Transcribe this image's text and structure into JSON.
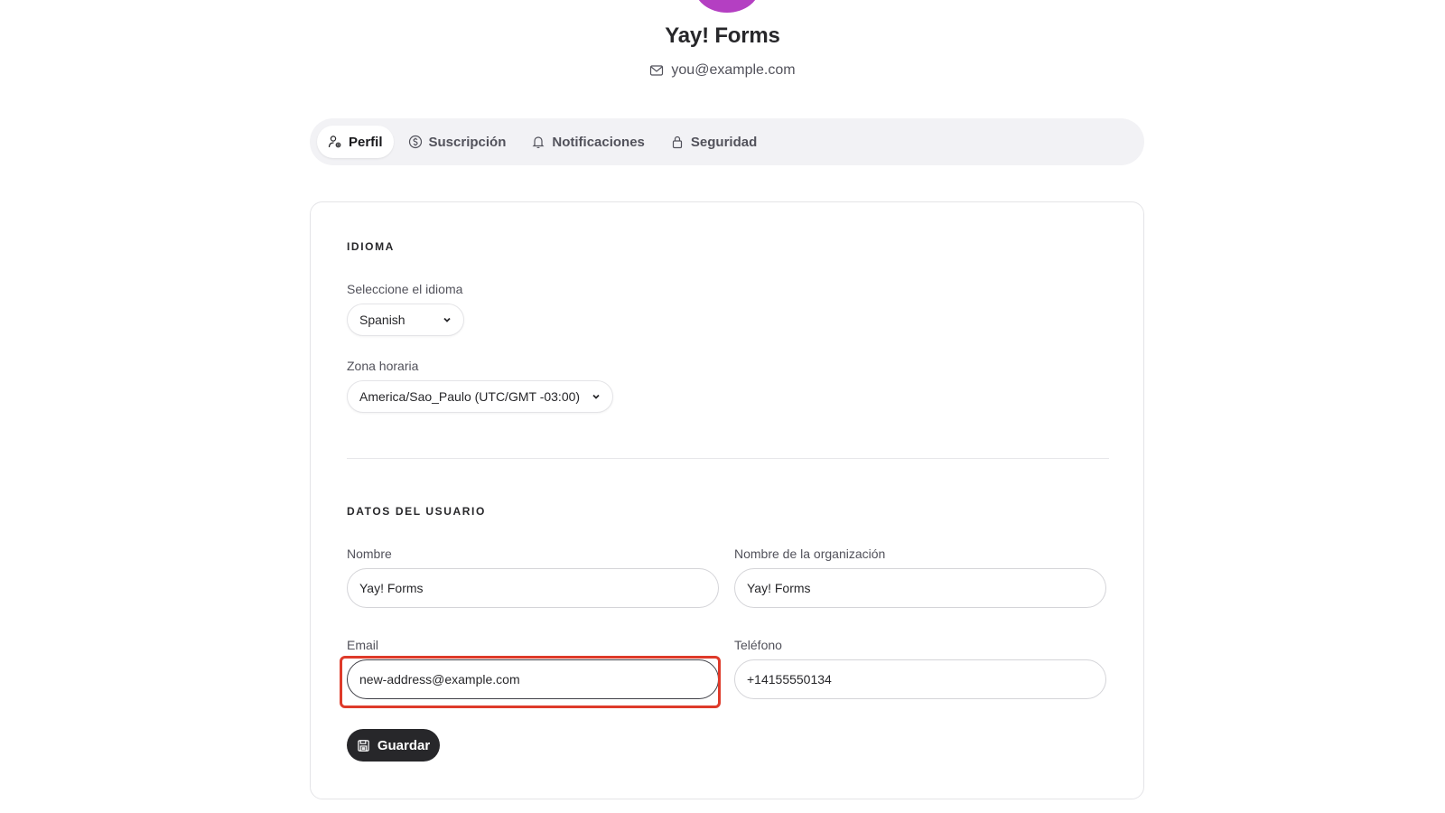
{
  "header": {
    "title": "Yay! Forms",
    "email": "you@example.com",
    "avatar_color": "#b43fc2"
  },
  "tabs": [
    {
      "label": "Perfil",
      "icon": "user-gear-icon",
      "active": true
    },
    {
      "label": "Suscripción",
      "icon": "dollar-circle-icon",
      "active": false
    },
    {
      "label": "Notificaciones",
      "icon": "bell-icon",
      "active": false
    },
    {
      "label": "Seguridad",
      "icon": "lock-icon",
      "active": false
    }
  ],
  "language_section": {
    "title": "IDIOMA",
    "language_label": "Seleccione el idioma",
    "language_value": "Spanish",
    "timezone_label": "Zona horaria",
    "timezone_value": "America/Sao_Paulo (UTC/GMT -03:00)"
  },
  "user_section": {
    "title": "DATOS DEL USUARIO",
    "name_label": "Nombre",
    "name_value": "Yay! Forms",
    "org_label": "Nombre de la organización",
    "org_value": "Yay! Forms",
    "email_label": "Email",
    "email_value": "new-address@example.com",
    "phone_label": "Teléfono",
    "phone_value": "+14155550134",
    "highlight_color": "#de3a2a"
  },
  "actions": {
    "save_label": "Guardar",
    "save_icon": "floppy-disk-icon",
    "save_bg": "#27272a"
  }
}
